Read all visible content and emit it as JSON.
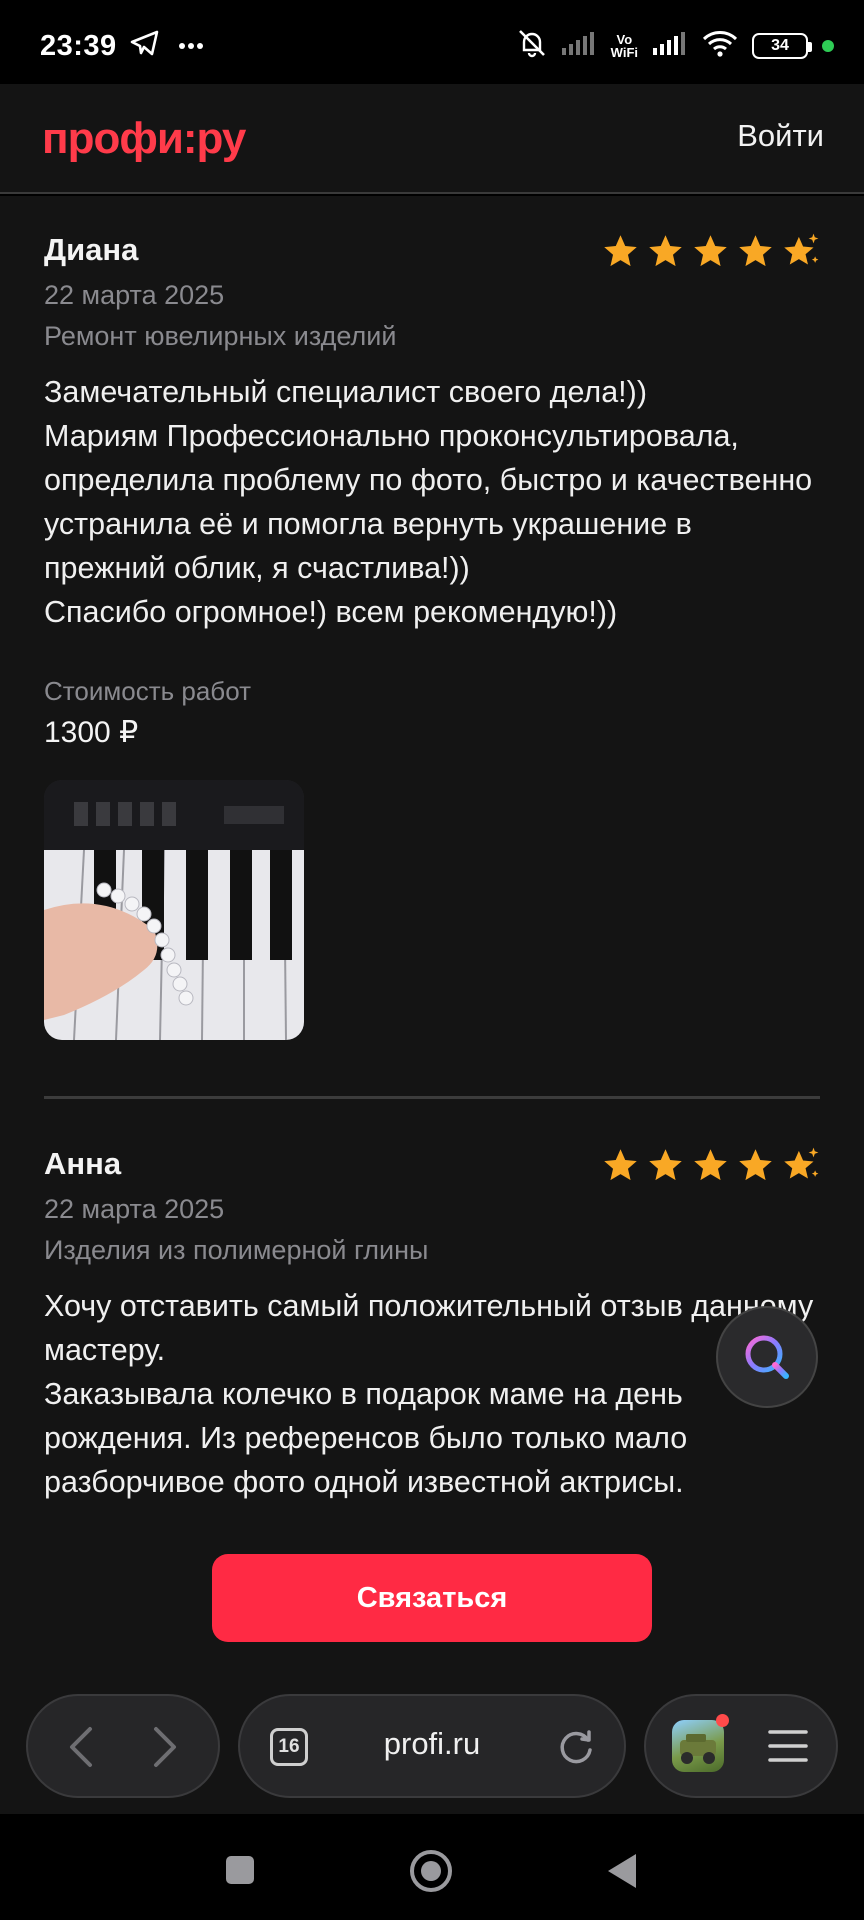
{
  "status_bar": {
    "time": "23:39",
    "left_icons": [
      "telegram-icon",
      "more-icon"
    ],
    "right_icons": [
      "mute-bell-icon",
      "signal-icon",
      "vowifi-icon",
      "signal-icon",
      "wifi-icon",
      "battery-icon"
    ],
    "vowifi_line1": "Vo",
    "vowifi_line2": "WiFi",
    "battery_level": "34"
  },
  "header": {
    "logo": "профи:ру",
    "login_label": "Войти",
    "brand_color": "#ff3b4a"
  },
  "reviews": [
    {
      "name": "Диана",
      "rating_stars": 5,
      "date": "22 марта 2025",
      "category": "Ремонт ювелирных изделий",
      "text": "Замечательный специалист своего дела!))\nМариям Профессионально проконсультировала, определила проблему по фото, быстро и качественно устранила её и помогла вернуть украшение в прежний облик, я счастлива!))\nСпасибо огромное!) всем рекомендую!))",
      "cost_label": "Стоимость работ",
      "cost_value": "1300 ₽"
    },
    {
      "name": "Анна",
      "rating_stars": 5,
      "date": "22 марта 2025",
      "category": "Изделия из полимерной глины",
      "text": "Хочу отставить самый положительный отзыв данному мастеру.\nЗаказывала колечко в подарок маме на день рождения. Из референсов было только мало разборчивое фото одной известной актрисы."
    }
  ],
  "contact_button": "Связаться",
  "browser": {
    "tabs_count": "16",
    "url": "profi.ru"
  },
  "colors": {
    "star": "#f9a825",
    "button": "#ff2a44",
    "background": "#141414"
  }
}
